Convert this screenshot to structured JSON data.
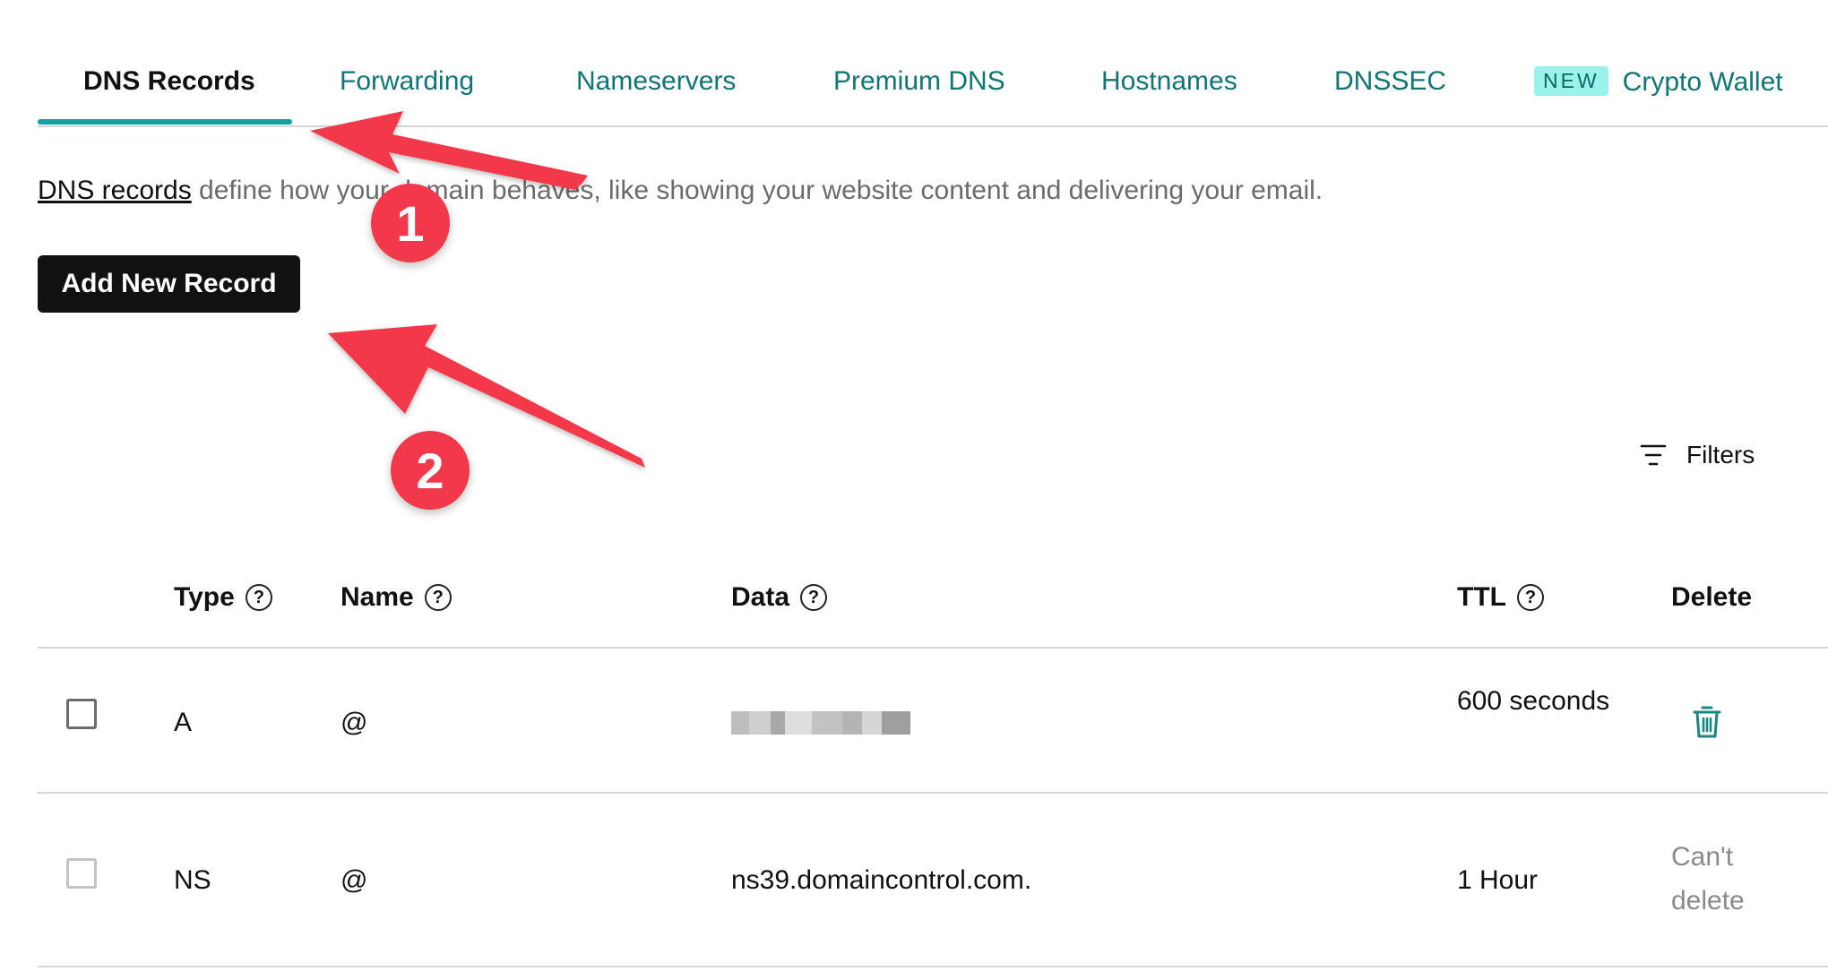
{
  "tabs": [
    {
      "label": "DNS Records"
    },
    {
      "label": "Forwarding"
    },
    {
      "label": "Nameservers"
    },
    {
      "label": "Premium DNS"
    },
    {
      "label": "Hostnames"
    },
    {
      "label": "DNSSEC"
    },
    {
      "label": "Crypto Wallet",
      "badge": "NEW"
    }
  ],
  "intro": {
    "link": "DNS records",
    "text": " define how your domain behaves, like showing your website content and delivering your email."
  },
  "add_button": "Add New Record",
  "filters_label": "Filters",
  "table": {
    "headers": {
      "type": "Type",
      "name": "Name",
      "data": "Data",
      "ttl": "TTL",
      "delete": "Delete"
    },
    "rows": [
      {
        "type": "A",
        "name": "@",
        "data": "",
        "ttl": "600 seconds",
        "delete": ""
      },
      {
        "type": "NS",
        "name": "@",
        "data": "ns39.domaincontrol.com.",
        "ttl": "1 Hour",
        "delete": "Can't delete"
      }
    ]
  },
  "annotations": {
    "step1": "1",
    "step2": "2"
  },
  "colors": {
    "accent": "#12a3a0",
    "link": "#0e7674",
    "badge_bg": "#9bf2ec",
    "annotation": "#f2384a",
    "button_bg": "#111111"
  }
}
